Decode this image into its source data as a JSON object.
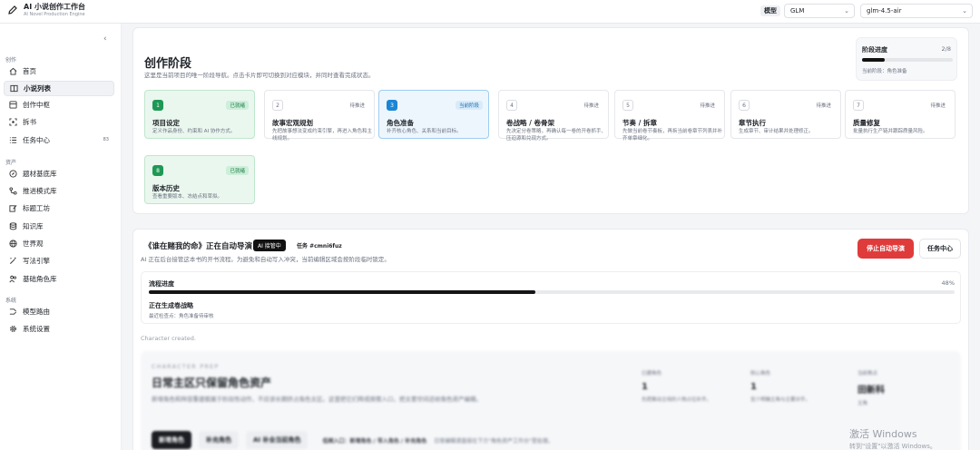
{
  "header": {
    "title": "AI 小说创作工作台",
    "subtitle": "AI Novel Production Engine",
    "model_label": "模型",
    "provider": "GLM",
    "model": "glm-4.5-air"
  },
  "sidebar": {
    "groups": {
      "create": "创作",
      "assets": "资产",
      "system": "系统"
    },
    "items": [
      {
        "label": "首页",
        "icon": "home-icon"
      },
      {
        "label": "小说列表",
        "icon": "book-icon",
        "active": true
      },
      {
        "label": "创作中枢",
        "icon": "layout-icon"
      },
      {
        "label": "拆书",
        "icon": "scan-icon"
      },
      {
        "label": "任务中心",
        "icon": "list-icon",
        "badge": "83"
      },
      {
        "label": "题材基底库",
        "icon": "compass-icon"
      },
      {
        "label": "推进模式库",
        "icon": "flow-icon"
      },
      {
        "label": "标题工坊",
        "icon": "edit-icon"
      },
      {
        "label": "知识库",
        "icon": "database-icon"
      },
      {
        "label": "世界观",
        "icon": "globe-icon"
      },
      {
        "label": "写法引擎",
        "icon": "wand-icon"
      },
      {
        "label": "基础角色库",
        "icon": "users-icon"
      },
      {
        "label": "模型路由",
        "icon": "route-icon"
      },
      {
        "label": "系统设置",
        "icon": "gear-icon"
      }
    ]
  },
  "stages": {
    "title": "创作阶段",
    "description": "这里是当前项目的唯一阶段导航。点击卡片即可切换到对应模块，并同时查看完成状态。",
    "progress": {
      "label": "阶段进度",
      "value": "2/8",
      "fraction": 0.25,
      "current": "当前阶段：角色准备"
    },
    "cards": [
      {
        "num": "1",
        "badge": "已就绪",
        "title": "项目设定",
        "desc": "定义作品身份、约束和 AI 协作方式。",
        "state": "done"
      },
      {
        "num": "2",
        "badge": "待推进",
        "title": "故事宏观规划",
        "desc": "先把故事想法变成约束引擎，再进入角色和主线规划。",
        "state": "pending"
      },
      {
        "num": "3",
        "badge": "当前阶段",
        "title": "角色准备",
        "desc": "补齐核心角色、关系和当前目标。",
        "state": "current"
      },
      {
        "num": "4",
        "badge": "待推进",
        "title": "卷战略 / 卷骨架",
        "desc": "先决定分卷策略，再确认每一卷的开卷抓手、压迫源和兑现方式。",
        "state": "pending"
      },
      {
        "num": "5",
        "badge": "待推进",
        "title": "节奏 / 拆章",
        "desc": "先做当前卷节奏板，再拆当前卷章节列表并补齐单章细化。",
        "state": "pending"
      },
      {
        "num": "6",
        "badge": "待推进",
        "title": "章节执行",
        "desc": "生成章节、审计结果并处理修正。",
        "state": "pending"
      },
      {
        "num": "7",
        "badge": "待推进",
        "title": "质量修复",
        "desc": "批量执行生产链并跟踪质量风险。",
        "state": "pending"
      },
      {
        "num": "8",
        "badge": "已就绪",
        "title": "版本历史",
        "desc": "查看重要版本、冻结点和草拟。",
        "state": "done"
      }
    ]
  },
  "automation": {
    "title": "《谁在赌我的命》正在自动导演",
    "ai_badge": "AI 接管中",
    "task": "任务 #cmni6fuz",
    "description": "AI 正在后台接管这本书的开书流程。为避免和自动写入冲突，当前编辑区域会按阶段临时锁定。",
    "stop_button": "停止自动导演",
    "task_center_button": "任务中心",
    "flow_label": "流程进度",
    "flow_percent": "48%",
    "flow_fraction": 0.48,
    "status": "正在生成卷战略",
    "checkpoint": "最近检查点：角色准备待审核",
    "log": "Character created."
  },
  "character_prep": {
    "kicker": "CHARACTER PREP",
    "title": "日常主区只保留角色资产",
    "description": "新增角色和阵容重建都属于阶段性动作，不应该长期挤占角色主区。这里把它们降成按需入口，把主要空间还给角色资产编辑。",
    "stats": [
      {
        "label": "已建角色",
        "value": "1",
        "note": "先把推动主线的人物占位补齐。"
      },
      {
        "label": "核心角色",
        "value": "1",
        "note": "至少明确主角与主要对手。"
      },
      {
        "label": "当前焦点",
        "value": "田新科",
        "note": "主角"
      }
    ],
    "actions": {
      "new_role": "新增角色",
      "supplement_role": "补充角色",
      "ai_supplement": "AI 补全当前角色",
      "quick_entry": "低频入口：新增角色 / 导入角色 / 补充角色",
      "hint": "日常编辑请直接在下方\"角色资产工作台\"里处理。"
    }
  },
  "watermark": {
    "line1": "激活 Windows",
    "line2": "转到\"设置\"以激活 Windows。"
  }
}
